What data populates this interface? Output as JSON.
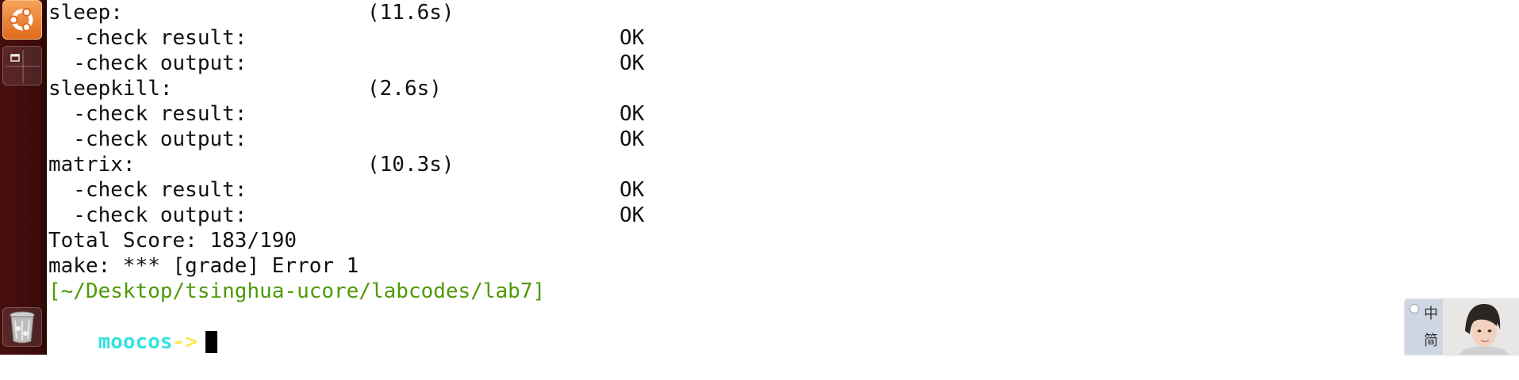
{
  "launcher": {
    "items": [
      {
        "name": "dash-home-button",
        "icon": "ubuntu-logo-icon"
      },
      {
        "name": "workspace-switcher-button",
        "icon": "workspace-icon"
      },
      {
        "name": "trash-button",
        "icon": "trash-icon"
      }
    ]
  },
  "terminal": {
    "lines": [
      {
        "c1": "sleep:",
        "c2": "(11.6s)",
        "c3": ""
      },
      {
        "c1": "  -check result:",
        "c2": "",
        "c3": "OK"
      },
      {
        "c1": "  -check output:",
        "c2": "",
        "c3": "OK"
      },
      {
        "c1": "sleepkill:",
        "c2": "(2.6s)",
        "c3": ""
      },
      {
        "c1": "  -check result:",
        "c2": "",
        "c3": "OK"
      },
      {
        "c1": "  -check output:",
        "c2": "",
        "c3": "OK"
      },
      {
        "c1": "matrix:",
        "c2": "(10.3s)",
        "c3": ""
      },
      {
        "c1": "  -check result:",
        "c2": "",
        "c3": "OK"
      },
      {
        "c1": "  -check output:",
        "c2": "",
        "c3": "OK"
      }
    ],
    "total_score": "Total Score: 183/190",
    "make_error": "make: *** [grade] Error 1",
    "cwd": "[~/Desktop/tsinghua-ucore/labcodes/lab7]",
    "prompt_user": "moocos",
    "prompt_arrow": "->",
    "colors": {
      "path": "#4e9a06",
      "prompt_user": "#34e2e2",
      "prompt_arrow": "#fce94f"
    }
  },
  "ime": {
    "key_top": "中",
    "key_bottom": "简"
  }
}
